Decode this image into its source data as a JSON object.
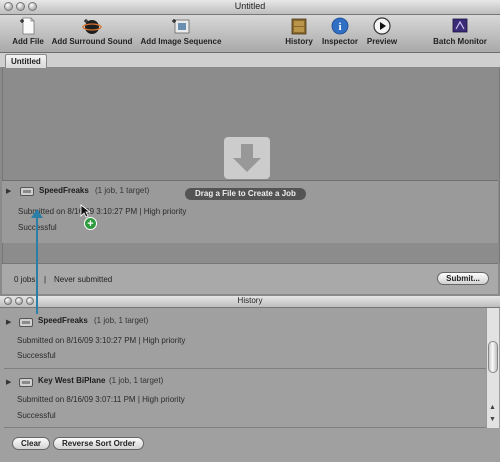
{
  "window": {
    "title": "Untitled"
  },
  "toolbar": {
    "add_file": "Add File",
    "add_surround_sound": "Add Surround Sound",
    "add_image_sequence": "Add Image Sequence",
    "history": "History",
    "inspector": "Inspector",
    "preview": "Preview",
    "batch_monitor": "Batch Monitor"
  },
  "tabs": [
    {
      "label": "Untitled"
    }
  ],
  "drop_zone": {
    "hint": "Drag a File to Create a Job"
  },
  "batch_job": {
    "name": "SpeedFreaks",
    "meta": "(1 job, 1 target)",
    "submitted": "Submitted on 8/16/09 3:10:27 PM  |  High priority",
    "status": "Successful"
  },
  "status_bar": {
    "jobs": "0 jobs",
    "separator": "|",
    "submission": "Never submitted",
    "submit_button": "Submit..."
  },
  "history": {
    "title": "History",
    "entries": [
      {
        "name": "SpeedFreaks",
        "meta": "(1 job, 1 target)",
        "submitted": "Submitted on 8/16/09 3:10:27 PM  |  High priority",
        "status": "Successful"
      },
      {
        "name": "Key West BiPlane",
        "meta": "(1 job, 1 target)",
        "submitted": "Submitted on 8/16/09 3:07:11 PM  |  High priority",
        "status": "Successful"
      }
    ],
    "clear_button": "Clear",
    "reverse_button": "Reverse Sort Order"
  },
  "colors": {
    "pointer": "#2b7fa7",
    "plus_badge": "#2e9b3f",
    "inspector_blue": "#2f6fc4"
  }
}
